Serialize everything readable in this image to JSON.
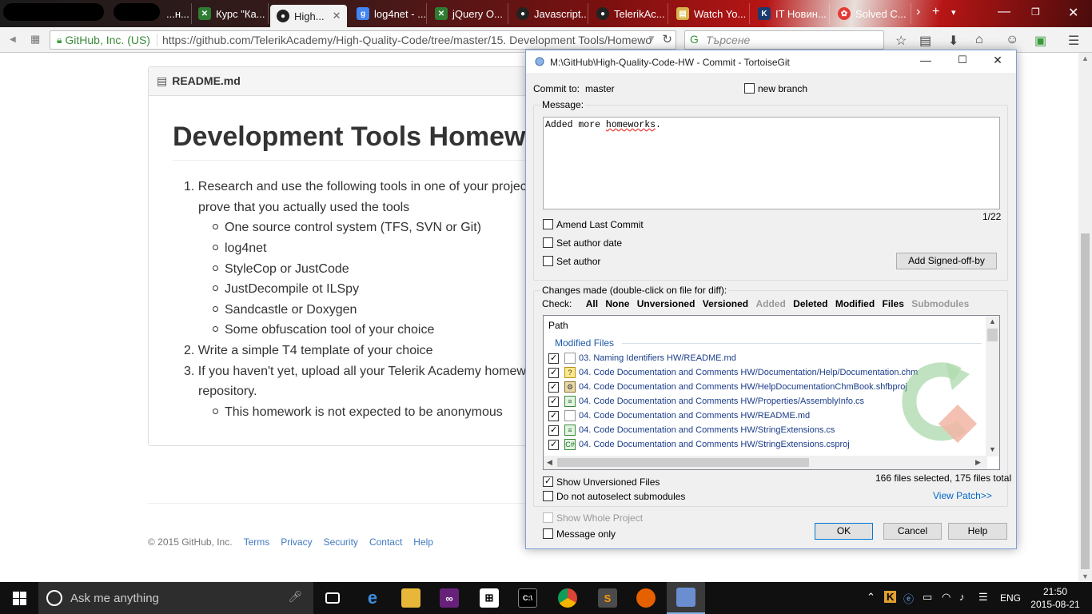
{
  "browser": {
    "tabs": [
      {
        "label": "...н..."
      },
      {
        "label": "Курс \"Ка..."
      },
      {
        "label": "High..."
      },
      {
        "label": "log4net - ..."
      },
      {
        "label": "jQuery O..."
      },
      {
        "label": "Javascript..."
      },
      {
        "label": "TelerikAc..."
      },
      {
        "label": "Watch Yo..."
      },
      {
        "label": "IT Новин..."
      },
      {
        "label": "Solved C..."
      }
    ],
    "tab_close": "✕",
    "new_tab": "+",
    "overflow": "›",
    "org_label": "GitHub, Inc. (US)",
    "url_prefix": "https://github.com",
    "url_path": "/TelerikAcademy/High-Quality-Code/tree/master/15. Development Tools/Homewo",
    "search_placeholder": "Търсене"
  },
  "readme": {
    "header": "README.md",
    "title": "Development Tools Homew",
    "items": [
      {
        "n": "1.",
        "text": "Research and use the following tools in one of your projec"
      },
      {
        "n": "",
        "text": "prove that you actually used the tools"
      },
      {
        "sub": "One source control system (TFS, SVN or Git)"
      },
      {
        "sub": "log4net"
      },
      {
        "sub": "StyleCop or JustCode"
      },
      {
        "sub": "JustDecompile ot ILSpy"
      },
      {
        "sub": "Sandcastle or Doxygen"
      },
      {
        "sub": "Some obfuscation tool of your choice"
      },
      {
        "n": "2.",
        "text": "Write a simple T4 template of your choice"
      },
      {
        "n": "3.",
        "text": "If you haven't yet, upload all your Telerik Academy homew"
      },
      {
        "n": "",
        "text": "repository."
      },
      {
        "sub": "This homework is not expected to be anonymous"
      }
    ]
  },
  "footer": {
    "copyright": "© 2015 GitHub, Inc.",
    "links": [
      "Terms",
      "Privacy",
      "Security",
      "Contact",
      "Help"
    ]
  },
  "dialog": {
    "title": "M:\\GitHub\\High-Quality-Code-HW - Commit - TortoiseGit",
    "commit_to_label": "Commit to:",
    "branch": "master",
    "new_branch": "new branch",
    "message_label": "Message:",
    "message_prefix": "Added more ",
    "message_word": "homeworks",
    "message_suffix": ".",
    "char_count": "1/22",
    "amend": "Amend Last Commit",
    "set_author_date": "Set author date",
    "set_author": "Set author",
    "add_signed_off": "Add Signed-off-by",
    "changes_label": "Changes made (double-click on file for diff):",
    "check_label": "Check:",
    "filters": [
      {
        "label": "All",
        "dim": false
      },
      {
        "label": "None",
        "dim": false
      },
      {
        "label": "Unversioned",
        "dim": false
      },
      {
        "label": "Versioned",
        "dim": false
      },
      {
        "label": "Added",
        "dim": true
      },
      {
        "label": "Deleted",
        "dim": false
      },
      {
        "label": "Modified",
        "dim": false
      },
      {
        "label": "Files",
        "dim": false
      },
      {
        "label": "Submodules",
        "dim": true
      }
    ],
    "list_header": "Path",
    "group_modified": "Modified Files",
    "files": [
      {
        "path": "03. Naming Identifiers HW/README.md",
        "icon": "md"
      },
      {
        "path": "04. Code Documentation and Comments HW/Documentation/Help/Documentation.chm",
        "icon": "chm"
      },
      {
        "path": "04. Code Documentation and Comments HW/HelpDocumentationChmBook.shfbproj",
        "icon": "proj"
      },
      {
        "path": "04. Code Documentation and Comments HW/Properties/AssemblyInfo.cs",
        "icon": "cs"
      },
      {
        "path": "04. Code Documentation and Comments HW/README.md",
        "icon": "md"
      },
      {
        "path": "04. Code Documentation and Comments HW/StringExtensions.cs",
        "icon": "cs"
      },
      {
        "path": "04. Code Documentation and Comments HW/StringExtensions.csproj",
        "icon": "csproj"
      }
    ],
    "show_unversioned": "Show Unversioned Files",
    "no_autoselect": "Do not autoselect submodules",
    "selection_status": "166 files selected, 175 files total",
    "view_patch": "View Patch>>",
    "show_whole_project": "Show Whole Project",
    "message_only": "Message only",
    "ok": "OK",
    "cancel": "Cancel",
    "help": "Help"
  },
  "taskbar": {
    "search_placeholder": "Ask me anything",
    "language": "ENG",
    "time": "21:50",
    "date": "2015-08-21"
  }
}
